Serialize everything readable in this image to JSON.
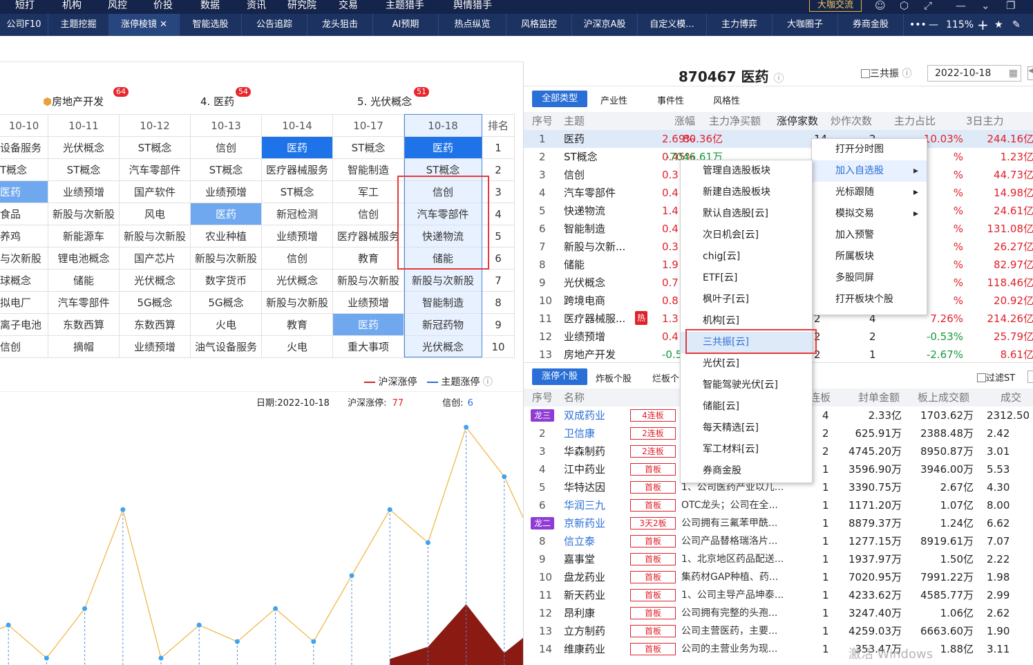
{
  "menu": [
    "短打",
    "机构",
    "风控",
    "价投",
    "数据",
    "资讯",
    "研究院",
    "交易",
    "主题猎手",
    "舆情猎手"
  ],
  "menu_badge": "大咖交流",
  "tabs": [
    "公司F10",
    "主题挖掘",
    "涨停棱镜",
    "智能选股",
    "公告追踪",
    "龙头狙击",
    "AI预期",
    "热点纵览",
    "风格监控",
    "沪深京A股",
    "自定义模...",
    "主力博弈",
    "大咖圈子",
    "券商金股"
  ],
  "zoom": "115%",
  "left": {
    "top_themes": [
      {
        "name": "房地产开发",
        "count": "64"
      },
      {
        "name": "4. 医药",
        "count": "54"
      },
      {
        "name": "5. 光伏概念",
        "count": "51"
      }
    ],
    "dates": [
      "10-10",
      "10-11",
      "10-12",
      "10-13",
      "10-14",
      "10-17",
      "10-18"
    ],
    "rank_header": "排名",
    "grid": [
      [
        "设备服务",
        "光伏概念",
        "ST概念",
        "信创",
        "医药",
        "ST概念",
        "医药"
      ],
      [
        "T概念",
        "ST概念",
        "汽车零部件",
        "ST概念",
        "医疗器械服务",
        "智能制造",
        "ST概念"
      ],
      [
        "医药",
        "业绩预增",
        "国产软件",
        "业绩预增",
        "ST概念",
        "军工",
        "信创"
      ],
      [
        "食品",
        "新股与次新股",
        "风电",
        "医药",
        "新冠检测",
        "信创",
        "汽车零部件"
      ],
      [
        "养鸡",
        "新能源车",
        "新股与次新股",
        "农业种植",
        "业绩预增",
        "医疗器械服务",
        "快递物流"
      ],
      [
        "与次新股",
        "锂电池概念",
        "国产芯片",
        "新股与次新股",
        "信创",
        "教育",
        "储能"
      ],
      [
        "球概念",
        "储能",
        "光伏概念",
        "数字货币",
        "光伏概念",
        "新股与次新股",
        "新股与次新股"
      ],
      [
        "拟电厂",
        "汽车零部件",
        "5G概念",
        "5G概念",
        "新股与次新股",
        "业绩预增",
        "智能制造"
      ],
      [
        "离子电池",
        "东数西算",
        "东数西算",
        "火电",
        "教育",
        "医药",
        "新冠药物"
      ],
      [
        "信创",
        "摘帽",
        "业绩预增",
        "油气设备服务",
        "火电",
        "重大事项",
        "光伏概念"
      ]
    ],
    "ranks": [
      "1",
      "2",
      "3",
      "4",
      "5",
      "6",
      "7",
      "8",
      "9",
      "10"
    ],
    "legend": {
      "a": "沪深涨停",
      "b": "主题涨停"
    },
    "info": {
      "date_label": "日期:",
      "date": "2022-10-18",
      "hs_label": "沪深涨停:",
      "hs": "77",
      "theme_label": "信创:",
      "theme": "6"
    }
  },
  "chart_data": {
    "type": "line",
    "title": "",
    "series": [
      {
        "name": "主题涨停",
        "color": "#f0b23c",
        "values": [
          1,
          2,
          0,
          3,
          9,
          0,
          2,
          1,
          3,
          1,
          5,
          9,
          7,
          14,
          11,
          6
        ]
      },
      {
        "name": "沪深涨停",
        "color": "#8b1a12",
        "values": [
          null,
          null,
          null,
          null,
          null,
          null,
          null,
          null,
          null,
          null,
          null,
          4,
          12,
          40,
          8,
          28
        ]
      }
    ],
    "grid": false
  },
  "right": {
    "title": "870467 医药",
    "sangongzhen": "三共振",
    "date": "2022-10-18",
    "filters": [
      "全部类型",
      "产业性",
      "事件性",
      "风格性"
    ],
    "headers": [
      "序号",
      "主题",
      "涨幅",
      "主力净买额",
      "涨停家数",
      "炒作次数",
      "主力占比",
      "3日主力"
    ],
    "rows": [
      [
        "1",
        "医药",
        "2.69%",
        "80.36亿",
        "14",
        "2",
        "10.03%",
        "244.16亿"
      ],
      [
        "2",
        "ST概念",
        "0.45%",
        "-7046.61万",
        "",
        "",
        "%",
        "1.23亿"
      ],
      [
        "3",
        "信创",
        "0.3",
        "",
        "",
        "",
        "%",
        "44.73亿"
      ],
      [
        "4",
        "汽车零部件",
        "0.4",
        "",
        "",
        "",
        "%",
        "14.98亿"
      ],
      [
        "5",
        "快递物流",
        "1.4",
        "",
        "",
        "",
        "%",
        "24.61亿"
      ],
      [
        "6",
        "智能制造",
        "0.4",
        "",
        "",
        "",
        "%",
        "131.08亿"
      ],
      [
        "7",
        "新股与次新...",
        "0.3",
        "",
        "",
        "",
        "%",
        "26.27亿"
      ],
      [
        "8",
        "储能",
        "1.9",
        "",
        "",
        "",
        "%",
        "82.97亿"
      ],
      [
        "9",
        "光伏概念",
        "0.7",
        "",
        "",
        "",
        "%",
        "118.46亿"
      ],
      [
        "10",
        "跨境电商",
        "0.8",
        "",
        "",
        "",
        "%",
        "20.92亿"
      ],
      [
        "11",
        "医疗器械服...",
        "1.3",
        "",
        "2",
        "4",
        "7.26%",
        "214.26亿"
      ],
      [
        "12",
        "业绩预增",
        "0.4",
        "",
        "2",
        "2",
        "-0.53%",
        "25.79亿"
      ],
      [
        "13",
        "房地产开发",
        "-0.5",
        "",
        "2",
        "1",
        "-2.67%",
        "8.61亿"
      ]
    ],
    "hot_tag": "热",
    "sub_tabs": [
      "涨停个股",
      "炸板个股",
      "烂板个"
    ],
    "filter_st": "过滤ST",
    "stock_headers": [
      "序号",
      "名称",
      "连板",
      "封单金额",
      "板上成交额",
      "成交"
    ],
    "stocks": [
      {
        "no": "龙三",
        "name": "双成药业",
        "tag": "4连板",
        "desc": "",
        "lb": "4",
        "fd": "2.33亿",
        "bs": "1703.62万",
        "cj": "2312.50"
      },
      {
        "no": "2",
        "name": "卫信康",
        "tag": "2连板",
        "desc": "",
        "lb": "2",
        "fd": "625.91万",
        "bs": "2388.48万",
        "cj": "2.42"
      },
      {
        "no": "3",
        "name": "华森制药",
        "tag": "2连板",
        "desc": "",
        "lb": "2",
        "fd": "4745.20万",
        "bs": "8950.87万",
        "cj": "3.01"
      },
      {
        "no": "4",
        "name": "江中药业",
        "tag": "首板",
        "desc": "",
        "lb": "1",
        "fd": "3596.90万",
        "bs": "3946.00万",
        "cj": "5.53"
      },
      {
        "no": "5",
        "name": "华特达因",
        "tag": "首板",
        "desc": "1、公司医药产业以儿...",
        "lb": "1",
        "fd": "3390.75万",
        "bs": "2.67亿",
        "cj": "4.30"
      },
      {
        "no": "6",
        "name": "华润三九",
        "tag": "首板",
        "desc": "OTC龙头；公司在全...",
        "lb": "1",
        "fd": "1171.20万",
        "bs": "1.07亿",
        "cj": "8.00"
      },
      {
        "no": "龙二",
        "name": "京新药业",
        "tag": "3天2板",
        "desc": "公司拥有三氟苯甲酰...",
        "lb": "1",
        "fd": "8879.37万",
        "bs": "1.24亿",
        "cj": "6.62"
      },
      {
        "no": "8",
        "name": "信立泰",
        "tag": "首板",
        "desc": "公司产品替格瑞洛片...",
        "lb": "1",
        "fd": "1277.15万",
        "bs": "8919.61万",
        "cj": "7.07"
      },
      {
        "no": "9",
        "name": "嘉事堂",
        "tag": "首板",
        "desc": "1、北京地区药品配送...",
        "lb": "1",
        "fd": "1937.97万",
        "bs": "1.50亿",
        "cj": "2.22"
      },
      {
        "no": "10",
        "name": "盘龙药业",
        "tag": "首板",
        "desc": "集药材GAP种植、药...",
        "lb": "1",
        "fd": "7020.95万",
        "bs": "7991.22万",
        "cj": "1.98"
      },
      {
        "no": "11",
        "name": "新天药业",
        "tag": "首板",
        "desc": "1、公司主导产品坤泰...",
        "lb": "1",
        "fd": "4233.62万",
        "bs": "4585.77万",
        "cj": "2.99"
      },
      {
        "no": "12",
        "name": "昂利康",
        "tag": "首板",
        "desc": "公司拥有完整的头孢...",
        "lb": "1",
        "fd": "3247.40万",
        "bs": "1.06亿",
        "cj": "2.62"
      },
      {
        "no": "13",
        "name": "立方制药",
        "tag": "首板",
        "desc": "公司主营医药，主要...",
        "lb": "1",
        "fd": "4259.03万",
        "bs": "6663.60万",
        "cj": "1.90"
      },
      {
        "no": "14",
        "name": "维康药业",
        "tag": "首板",
        "desc": "公司的主营业务为现...",
        "lb": "1",
        "fd": "353.47万",
        "bs": "1.88亿",
        "cj": "3.11"
      }
    ],
    "ctx_main": [
      "打开分时图",
      "加入自选股",
      "光标跟随",
      "模拟交易",
      "加入预警",
      "所属板块",
      "多股同屏",
      "打开板块个股"
    ],
    "ctx_sub": [
      "管理自选股板块",
      "新建自选股板块",
      "默认自选股[云]",
      "次日机会[云]",
      "chig[云]",
      "ETF[云]",
      "枫叶子[云]",
      "机构[云]",
      "三共振[云]",
      "光伏[云]",
      "智能驾驶光伏[云]",
      "储能[云]",
      "每天精选[云]",
      "军工材料[云]",
      "券商金股"
    ],
    "watermark": "激活 Windows"
  }
}
